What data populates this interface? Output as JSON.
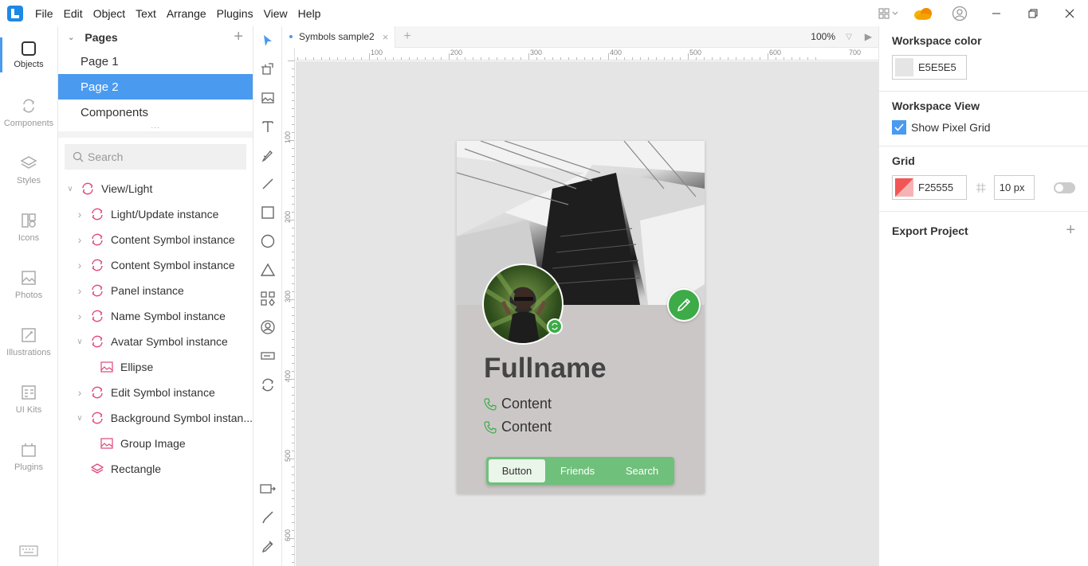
{
  "menu": [
    "File",
    "Edit",
    "Object",
    "Text",
    "Arrange",
    "Plugins",
    "View",
    "Help"
  ],
  "leftnav": [
    {
      "label": "Objects",
      "icon": "objects-icon"
    },
    {
      "label": "Components",
      "icon": "components-icon"
    },
    {
      "label": "Styles",
      "icon": "styles-icon"
    },
    {
      "label": "Icons",
      "icon": "icons-icon"
    },
    {
      "label": "Photos",
      "icon": "photos-icon"
    },
    {
      "label": "Illustrations",
      "icon": "illustrations-icon"
    },
    {
      "label": "UI Kits",
      "icon": "ui-kits-icon"
    },
    {
      "label": "Plugins",
      "icon": "plugins-icon"
    }
  ],
  "pages": {
    "title": "Pages",
    "items": [
      "Page 1",
      "Page 2",
      "Components"
    ],
    "selected": "Page 2"
  },
  "search": {
    "placeholder": "Search"
  },
  "layers": [
    {
      "label": "View/Light",
      "type": "symbol",
      "expanded": true
    },
    {
      "label": "Light/Update instance",
      "type": "symbol"
    },
    {
      "label": "Content Symbol instance",
      "type": "symbol"
    },
    {
      "label": "Content Symbol instance",
      "type": "symbol"
    },
    {
      "label": "Panel instance",
      "type": "symbol"
    },
    {
      "label": "Name Symbol instance",
      "type": "symbol"
    },
    {
      "label": "Avatar Symbol instance",
      "type": "symbol",
      "expanded": true
    },
    {
      "label": "Ellipse",
      "type": "image"
    },
    {
      "label": "Edit Symbol instance",
      "type": "symbol"
    },
    {
      "label": "Background Symbol instan...",
      "type": "symbol",
      "expanded": true
    },
    {
      "label": "Group Image",
      "type": "image"
    },
    {
      "label": "Rectangle",
      "type": "rectangle"
    }
  ],
  "tab": {
    "name": "Symbols sample2",
    "zoom": "100%"
  },
  "ruler": {
    "h": [
      "100",
      "200",
      "300",
      "400",
      "500",
      "600",
      "700"
    ],
    "v": [
      "100",
      "200",
      "300",
      "400",
      "500",
      "600"
    ]
  },
  "artboard": {
    "fullname": "Fullname",
    "content1": "Content",
    "content2": "Content",
    "buttons": [
      "Button",
      "Friends",
      "Search"
    ]
  },
  "right": {
    "workspace_color_title": "Workspace color",
    "workspace_color": "E5E5E5",
    "workspace_view_title": "Workspace View",
    "show_pixel_grid": "Show Pixel Grid",
    "grid_title": "Grid",
    "grid_color": "F25555",
    "grid_size": "10 px",
    "export_title": "Export Project"
  },
  "colors": {
    "accent": "#4a9af0",
    "green": "#3cab48",
    "symbol": "#e0457b",
    "canvas": "#e5e5e5"
  }
}
